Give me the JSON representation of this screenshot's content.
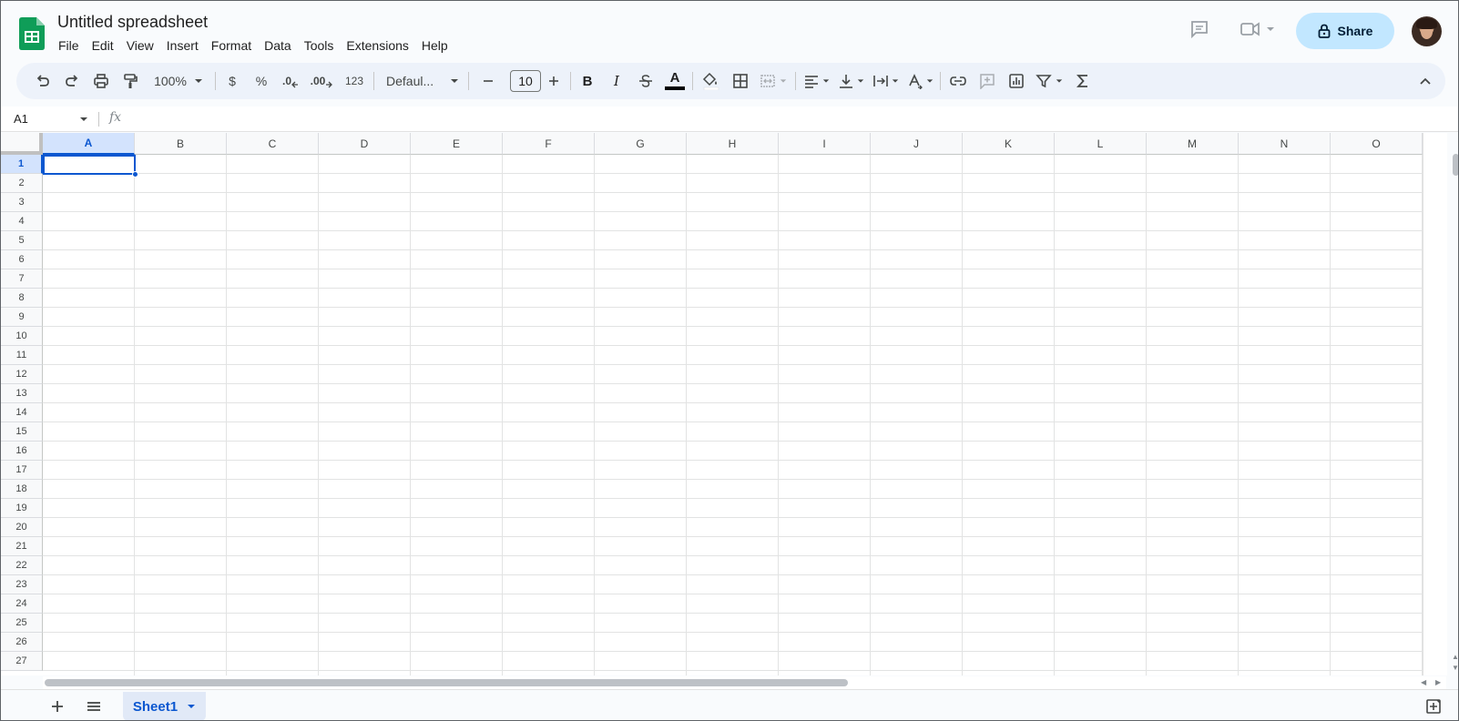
{
  "header": {
    "title": "Untitled spreadsheet",
    "menu": [
      "File",
      "Edit",
      "View",
      "Insert",
      "Format",
      "Data",
      "Tools",
      "Extensions",
      "Help"
    ],
    "share_label": "Share"
  },
  "toolbar": {
    "zoom": "100%",
    "currency": "$",
    "percent": "%",
    "dec_decrease": ".0",
    "dec_increase": ".00",
    "number_format": "123",
    "font": "Defaul...",
    "font_size": "10",
    "bold": "B",
    "italic": "I",
    "text_color_glyph": "A"
  },
  "formula_bar": {
    "cell_ref": "A1",
    "fx": "fx",
    "value": ""
  },
  "grid": {
    "columns": [
      "A",
      "B",
      "C",
      "D",
      "E",
      "F",
      "G",
      "H",
      "I",
      "J",
      "K",
      "L",
      "M",
      "N",
      "O"
    ],
    "rows": [
      "1",
      "2",
      "3",
      "4",
      "5",
      "6",
      "7",
      "8",
      "9",
      "10",
      "11",
      "12",
      "13",
      "14",
      "15",
      "16",
      "17",
      "18",
      "19",
      "20",
      "21",
      "22",
      "23",
      "24",
      "25",
      "26",
      "27"
    ],
    "selected_column": "A",
    "selected_row": "1"
  },
  "sheets": {
    "tabs": [
      {
        "label": "Sheet1",
        "active": true
      }
    ]
  },
  "colors": {
    "accent": "#0b57d0",
    "share_bg": "#c2e7ff",
    "logo_green": "#0f9d58"
  },
  "icons": {
    "undo": "undo-icon",
    "redo": "redo-icon",
    "print": "print-icon",
    "paint_format": "paint-format-icon",
    "comments": "comment-icon",
    "meet": "video-call-icon",
    "lock": "lock-icon"
  }
}
